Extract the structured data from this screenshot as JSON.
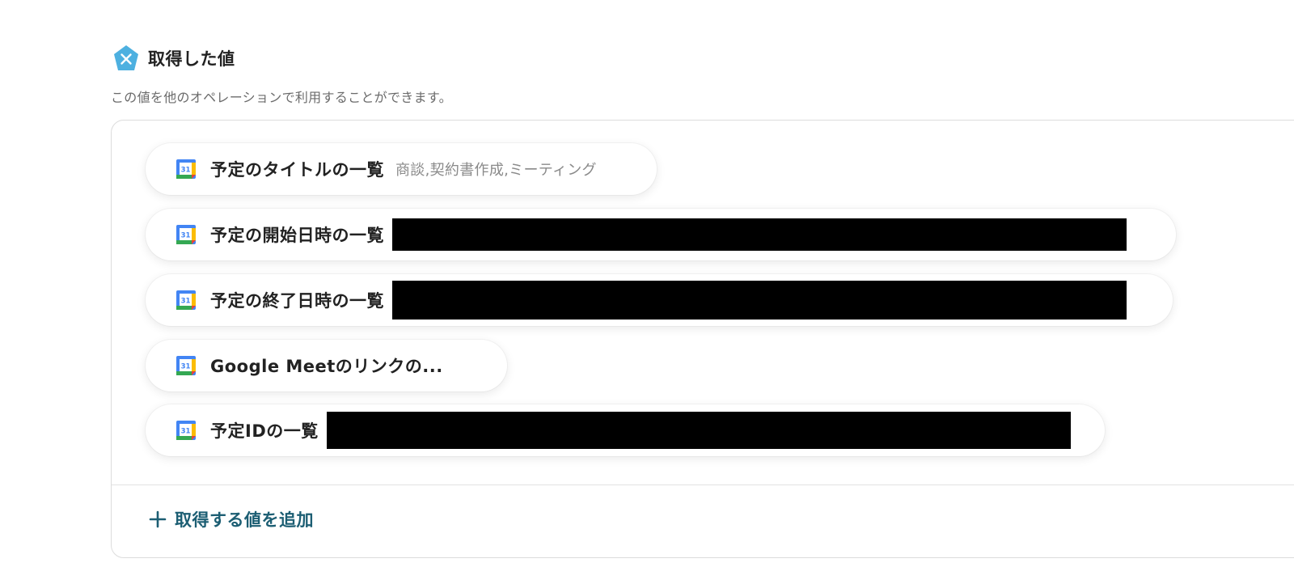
{
  "section": {
    "title": "取得した値",
    "badge_icon": "x-variable-icon",
    "description": "この値を他のオペレーションで利用することができます。"
  },
  "fields": [
    {
      "label": "予定のタイトルの一覧",
      "value": "商談,契約書作成,ミーティング",
      "redacted": false,
      "icon": "google-calendar-icon"
    },
    {
      "label": "予定の開始日時の一覧",
      "value": "",
      "redacted": true,
      "icon": "google-calendar-icon"
    },
    {
      "label": "予定の終了日時の一覧",
      "value": "",
      "redacted": true,
      "icon": "google-calendar-icon"
    },
    {
      "label": "Google Meetのリンクの...",
      "value": "",
      "redacted": false,
      "icon": "google-calendar-icon"
    },
    {
      "label": "予定IDの一覧",
      "value": "",
      "redacted": true,
      "icon": "google-calendar-icon"
    }
  ],
  "add_button": {
    "label": "取得する値を追加",
    "icon": "plus-icon"
  },
  "colors": {
    "badge": "#4db0e0",
    "add_text": "#1c5e73",
    "redaction": "#000000"
  }
}
